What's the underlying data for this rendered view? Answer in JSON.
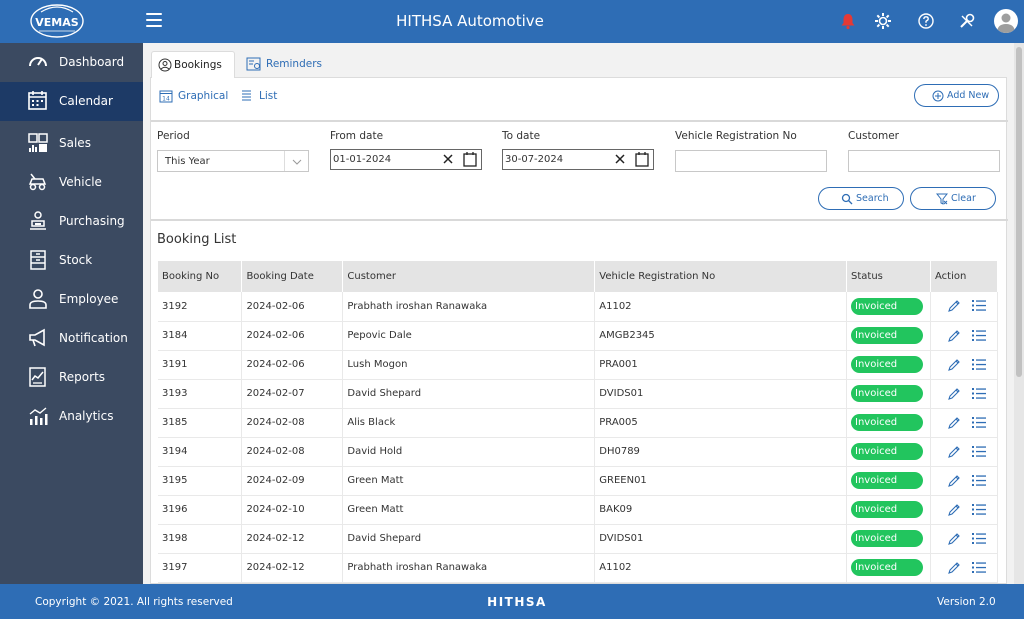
{
  "header": {
    "title": "HITHSA Automotive",
    "logo_text": "VEMAS"
  },
  "sidebar": {
    "items": [
      {
        "label": "Dashboard",
        "icon": "speedometer-icon"
      },
      {
        "label": "Calendar",
        "icon": "calendar-icon",
        "active": true
      },
      {
        "label": "Sales",
        "icon": "sales-icon"
      },
      {
        "label": "Vehicle",
        "icon": "vehicle-icon"
      },
      {
        "label": "Purchasing",
        "icon": "purchasing-icon"
      },
      {
        "label": "Stock",
        "icon": "stock-icon"
      },
      {
        "label": "Employee",
        "icon": "employee-icon"
      },
      {
        "label": "Notification",
        "icon": "megaphone-icon"
      },
      {
        "label": "Reports",
        "icon": "reports-icon"
      },
      {
        "label": "Analytics",
        "icon": "analytics-icon"
      }
    ]
  },
  "tabs": {
    "bookings": "Bookings",
    "reminders": "Reminders"
  },
  "views": {
    "graphical": "Graphical",
    "list": "List"
  },
  "actions": {
    "add_new": "Add New",
    "search": "Search",
    "clear": "Clear"
  },
  "filters": {
    "period_label": "Period",
    "period_value": "This Year",
    "from_label": "From date",
    "from_value": "01-01-2024",
    "to_label": "To date",
    "to_value": "30-07-2024",
    "vehicle_label": "Vehicle Registration No",
    "vehicle_value": "",
    "customer_label": "Customer",
    "customer_value": ""
  },
  "booking_list": {
    "title": "Booking List",
    "columns": [
      "Booking No",
      "Booking Date",
      "Customer",
      "Vehicle Registration No",
      "Status",
      "Action"
    ],
    "rows": [
      {
        "no": "3192",
        "date": "2024-02-06",
        "customer": "Prabhath iroshan Ranawaka",
        "vehicle": "A1102",
        "status": "Invoiced"
      },
      {
        "no": "3184",
        "date": "2024-02-06",
        "customer": "Pepovic Dale",
        "vehicle": "AMGB2345",
        "status": "Invoiced"
      },
      {
        "no": "3191",
        "date": "2024-02-06",
        "customer": "Lush Mogon",
        "vehicle": "PRA001",
        "status": "Invoiced"
      },
      {
        "no": "3193",
        "date": "2024-02-07",
        "customer": "David Shepard",
        "vehicle": "DVIDS01",
        "status": "Invoiced"
      },
      {
        "no": "3185",
        "date": "2024-02-08",
        "customer": "Alis Black",
        "vehicle": "PRA005",
        "status": "Invoiced"
      },
      {
        "no": "3194",
        "date": "2024-02-08",
        "customer": "David Hold",
        "vehicle": "DH0789",
        "status": "Invoiced"
      },
      {
        "no": "3195",
        "date": "2024-02-09",
        "customer": "Green Matt",
        "vehicle": "GREEN01",
        "status": "Invoiced"
      },
      {
        "no": "3196",
        "date": "2024-02-10",
        "customer": "Green Matt",
        "vehicle": "BAK09",
        "status": "Invoiced"
      },
      {
        "no": "3198",
        "date": "2024-02-12",
        "customer": "David Shepard",
        "vehicle": "DVIDS01",
        "status": "Invoiced"
      },
      {
        "no": "3197",
        "date": "2024-02-12",
        "customer": "Prabhath iroshan Ranawaka",
        "vehicle": "A1102",
        "status": "Invoiced"
      }
    ]
  },
  "footer": {
    "copyright": "Copyright © 2021. All rights reserved",
    "brand": "HITHSA",
    "version": "Version 2.0"
  },
  "colors": {
    "primary": "#2e6db5",
    "sidebar": "#3b4a61",
    "sidebar_active": "#1d3a66",
    "status_invoiced": "#22c55e",
    "notification": "#e53935"
  }
}
